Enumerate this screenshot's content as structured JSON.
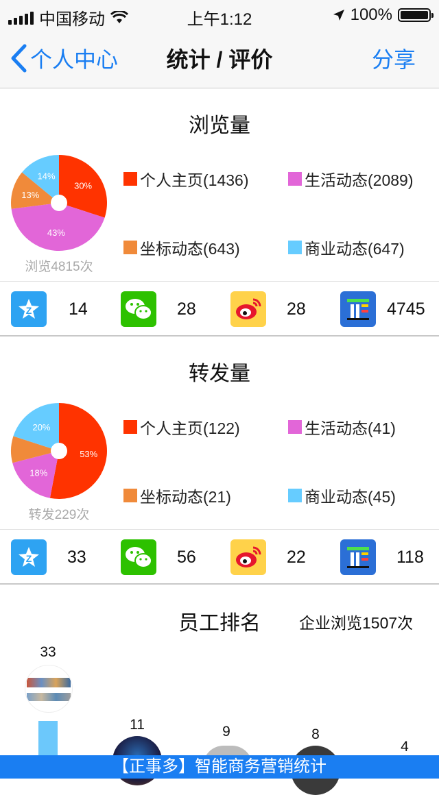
{
  "status": {
    "carrier": "中国移动",
    "time": "上午1:12",
    "battery": "100%"
  },
  "nav": {
    "back_label": "个人中心",
    "title": "统计 / 评价",
    "share_label": "分享"
  },
  "colors": {
    "accent": "#1a7ef2",
    "personal": "#ff3300",
    "life": "#e266d8",
    "coord": "#f08a3a",
    "business": "#66ccff"
  },
  "views": {
    "title": "浏览量",
    "caption": "浏览4815次",
    "slices": [
      {
        "label": "30%",
        "value": 30
      },
      {
        "label": "43%",
        "value": 43
      },
      {
        "label": "13%",
        "value": 13
      },
      {
        "label": "14%",
        "value": 14
      }
    ],
    "legend": [
      "个人主页(1436)",
      "生活动态(2089)",
      "坐标动态(643)",
      "商业动态(647)"
    ],
    "shares": [
      "14",
      "28",
      "28",
      "4745"
    ]
  },
  "forwards": {
    "title": "转发量",
    "caption": "转发229次",
    "slices": [
      {
        "label": "53%",
        "value": 53
      },
      {
        "label": "18%",
        "value": 18
      },
      {
        "label": "",
        "value": 9
      },
      {
        "label": "20%",
        "value": 20
      }
    ],
    "legend": [
      "个人主页(122)",
      "生活动态(41)",
      "坐标动态(21)",
      "商业动态(45)"
    ],
    "shares": [
      "33",
      "56",
      "22",
      "118"
    ]
  },
  "ranking": {
    "title": "员工排名",
    "subtitle": "企业浏览1507次",
    "values": [
      "33",
      "11",
      "9",
      "8",
      "4"
    ]
  },
  "footer": {
    "text": "【正事多】智能商务营销统计"
  },
  "icons": {
    "qzone": "qzone-icon",
    "wechat": "wechat-icon",
    "weibo": "weibo-icon",
    "app": "app-icon"
  }
}
